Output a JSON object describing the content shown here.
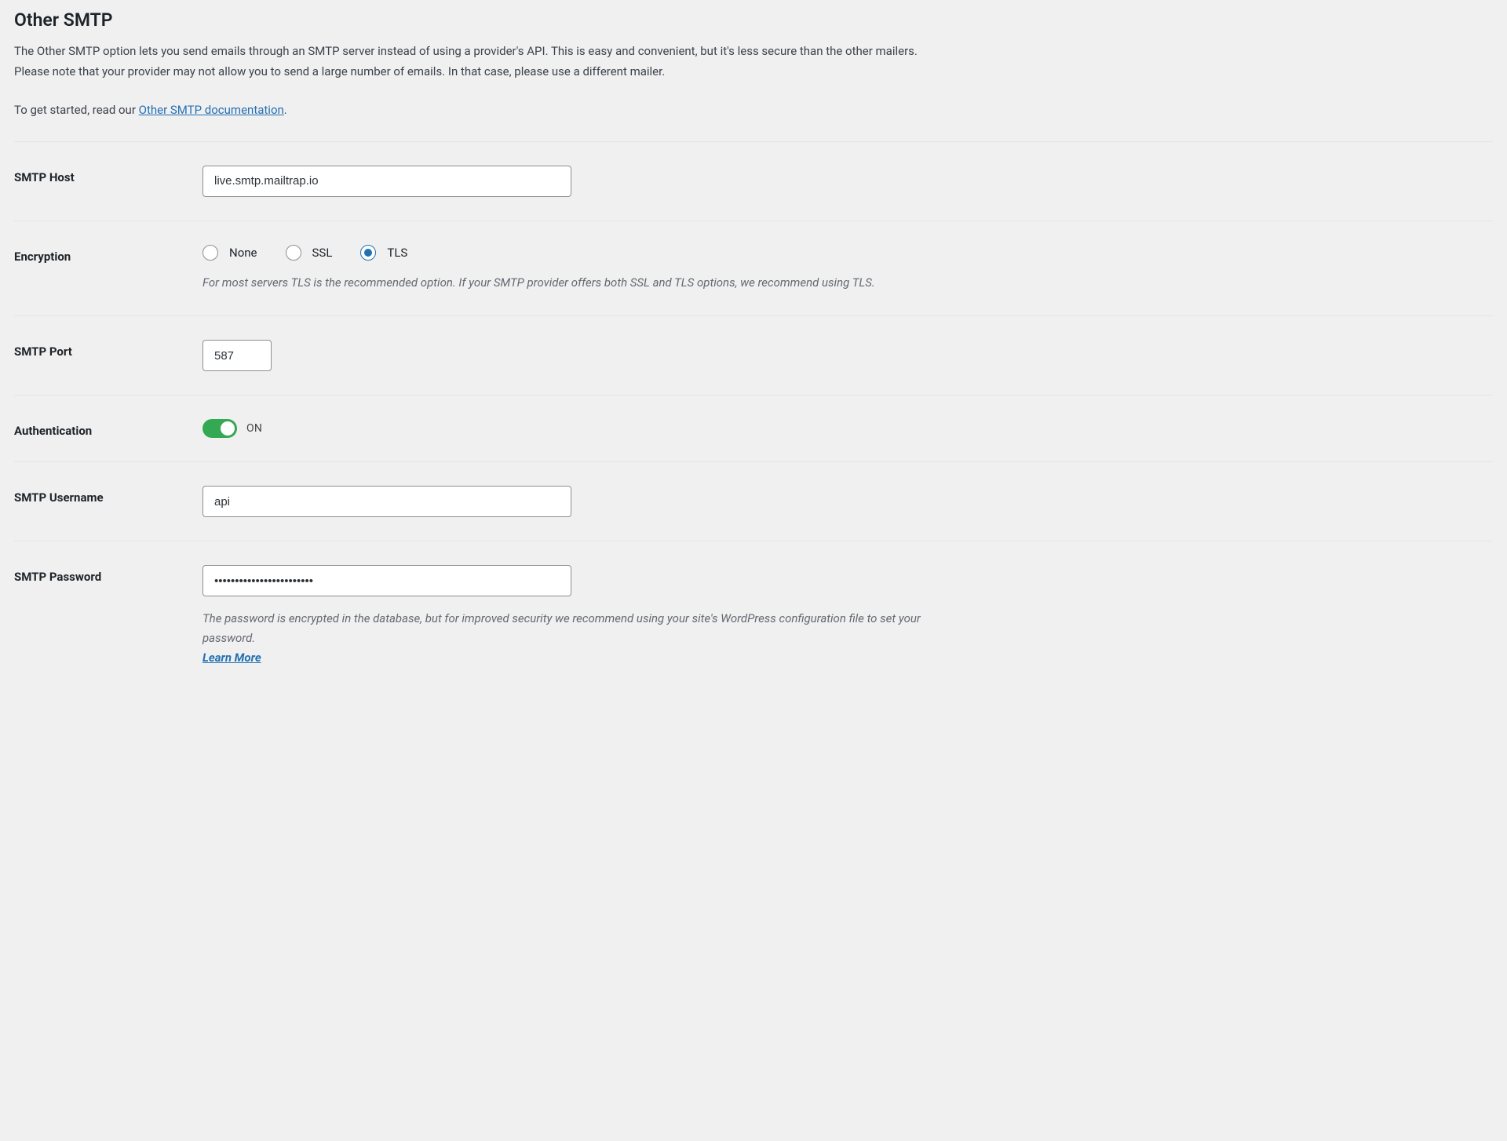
{
  "section": {
    "title": "Other SMTP",
    "intro_1": "The Other SMTP option lets you send emails through an SMTP server instead of using a provider's API. This is easy and convenient, but it's less secure than the other mailers. Please note that your provider may not allow you to send a large number of emails. In that case, please use a different mailer.",
    "intro_2_prefix": "To get started, read our ",
    "doc_link_text": "Other SMTP documentation",
    "intro_2_suffix": "."
  },
  "fields": {
    "smtp_host": {
      "label": "SMTP Host",
      "value": "live.smtp.mailtrap.io"
    },
    "encryption": {
      "label": "Encryption",
      "options": {
        "none": "None",
        "ssl": "SSL",
        "tls": "TLS"
      },
      "selected": "tls",
      "help": "For most servers TLS is the recommended option. If your SMTP provider offers both SSL and TLS options, we recommend using TLS."
    },
    "smtp_port": {
      "label": "SMTP Port",
      "value": "587"
    },
    "auth": {
      "label": "Authentication",
      "state_text": "ON",
      "on": true
    },
    "smtp_username": {
      "label": "SMTP Username",
      "value": "api"
    },
    "smtp_password": {
      "label": "SMTP Password",
      "value": "••••••••••••••••••••••••",
      "help": "The password is encrypted in the database, but for improved security we recommend using your site's WordPress configuration file to set your password.",
      "learn_more": "Learn More"
    }
  }
}
